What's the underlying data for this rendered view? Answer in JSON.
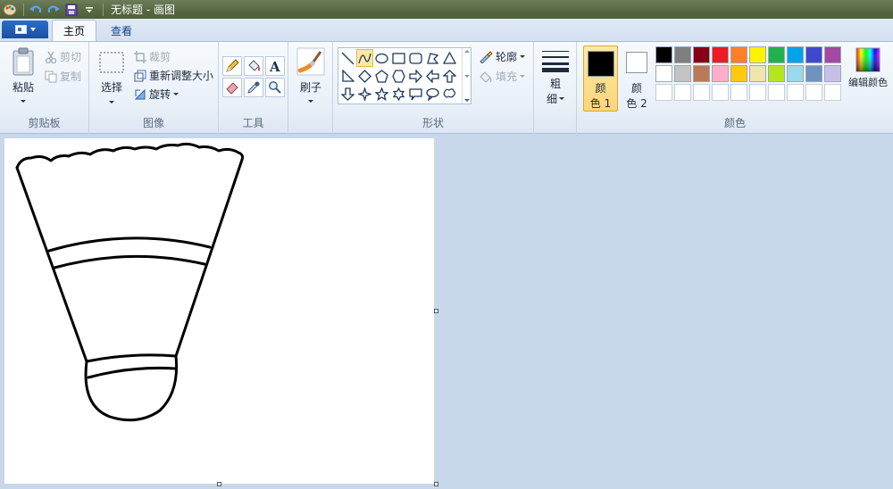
{
  "window": {
    "title": "无标题 - 画图"
  },
  "tabs": [
    {
      "label": "主页",
      "active": true
    },
    {
      "label": "查看",
      "active": false
    }
  ],
  "groups": {
    "clipboard": {
      "label": "剪贴板",
      "paste": "粘贴",
      "cut": "剪切",
      "copy": "复制"
    },
    "image": {
      "label": "图像",
      "select": "选择",
      "crop": "裁剪",
      "resize": "重新调整大小",
      "rotate": "旋转"
    },
    "tools": {
      "label": "工具",
      "items": [
        "pencil-icon",
        "fill-icon",
        "text-icon",
        "eraser-icon",
        "color-picker-icon",
        "magnifier-icon"
      ]
    },
    "brushes": {
      "label": "刷子"
    },
    "shapes": {
      "label": "形状",
      "outline": "轮廓",
      "fill": "填充",
      "selected": "curve"
    },
    "size": {
      "label_top": "粗",
      "label_bottom": "细"
    },
    "colors": {
      "label": "颜色",
      "color1_top": "颜",
      "color1_bottom": "色 1",
      "color2_top": "颜",
      "color2_bottom": "色 2",
      "edit": "编辑颜色",
      "color1": "#000000",
      "color2": "#ffffff",
      "palette_row1": [
        "#000000",
        "#7f7f7f",
        "#880015",
        "#ed1c24",
        "#ff7f27",
        "#fff200",
        "#22b14c",
        "#00a2e8",
        "#3f48cc",
        "#a349a4"
      ],
      "palette_row2": [
        "#ffffff",
        "#c3c3c3",
        "#b97a57",
        "#ffaec9",
        "#ffc90e",
        "#efe4b0",
        "#b5e61d",
        "#99d9ea",
        "#7092be",
        "#c8bfe7"
      ],
      "palette_row3": [
        "#ffffff",
        "#ffffff",
        "#ffffff",
        "#ffffff",
        "#ffffff",
        "#ffffff",
        "#ffffff",
        "#ffffff",
        "#ffffff",
        "#ffffff"
      ]
    }
  }
}
